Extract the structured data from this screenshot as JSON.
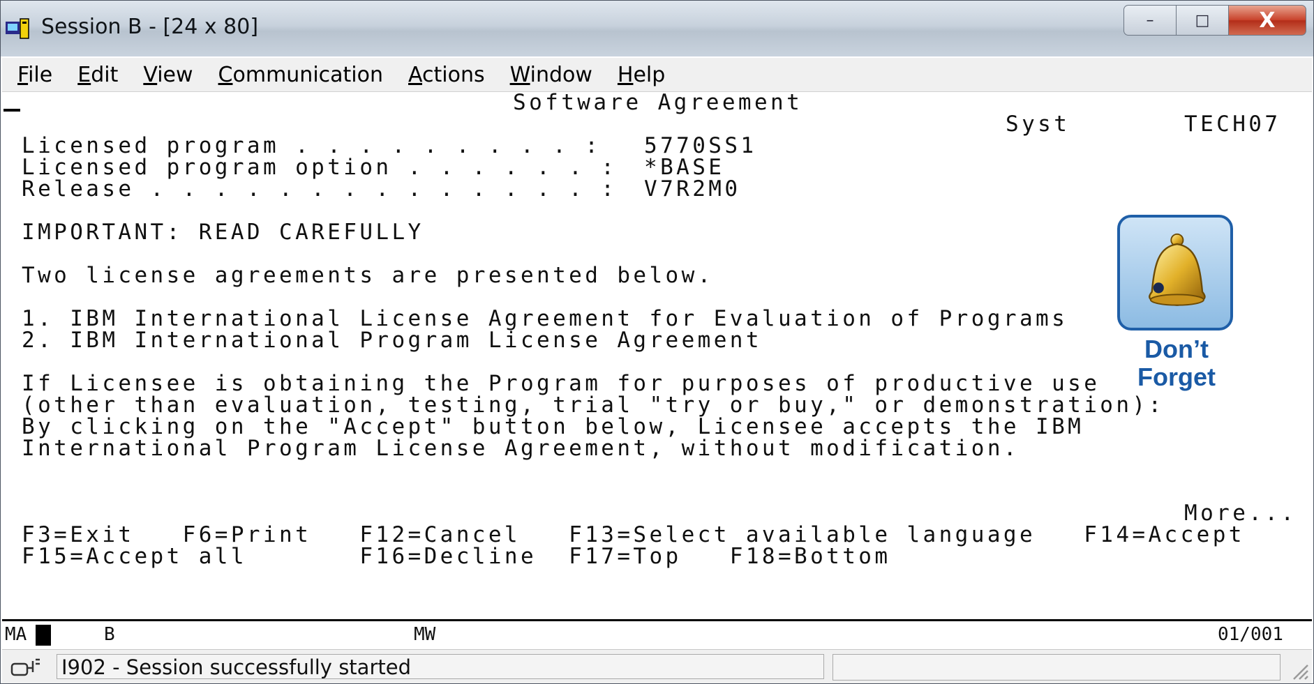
{
  "window": {
    "title": "Session B - [24 x 80]",
    "controls": {
      "minimize": "–",
      "maximize": "□",
      "close": "X"
    }
  },
  "menubar": [
    {
      "accel": "F",
      "rest": "ile"
    },
    {
      "accel": "E",
      "rest": "dit"
    },
    {
      "accel": "V",
      "rest": "iew"
    },
    {
      "accel": "C",
      "rest": "ommunication"
    },
    {
      "accel": "A",
      "rest": "ctions"
    },
    {
      "accel": "W",
      "rest": "indow"
    },
    {
      "accel": "H",
      "rest": "elp"
    }
  ],
  "screen": {
    "heading": "Software Agreement",
    "system_label": "Syst",
    "system_name": "TECH07",
    "fields": [
      {
        "label": "Licensed program . . . . . . . . . :",
        "value": "5770SS1"
      },
      {
        "label": "Licensed program option . . . . . . :",
        "value": "*BASE"
      },
      {
        "label": "Release . . . . . . . . . . . . . . :",
        "value": "V7R2M0"
      }
    ],
    "important": "IMPORTANT: READ CAREFULLY",
    "intro": "Two license agreements are presented below.",
    "agreements": [
      "1. IBM International License Agreement for Evaluation of Programs",
      "2. IBM International Program License Agreement"
    ],
    "body": [
      "If Licensee is obtaining the Program for purposes of productive use",
      "(other than evaluation, testing, trial \"try or buy,\" or demonstration):",
      "By clicking on the \"Accept\" button below, Licensee accepts the IBM",
      "International Program License Agreement, without modification."
    ],
    "more": "More...",
    "fkeys_row1": "F3=Exit   F6=Print   F12=Cancel   F13=Select available language   F14=Accept",
    "fkeys_row2": "F15=Accept all       F16=Decline  F17=Top   F18=Bottom"
  },
  "badge": {
    "line1": "Don’t",
    "line2": "Forget",
    "icon": "bell-icon"
  },
  "oia": {
    "mode": "MA",
    "session": "B",
    "mw": "MW",
    "position": "01/001"
  },
  "statusbar": {
    "message": "I902 - Session successfully started"
  }
}
